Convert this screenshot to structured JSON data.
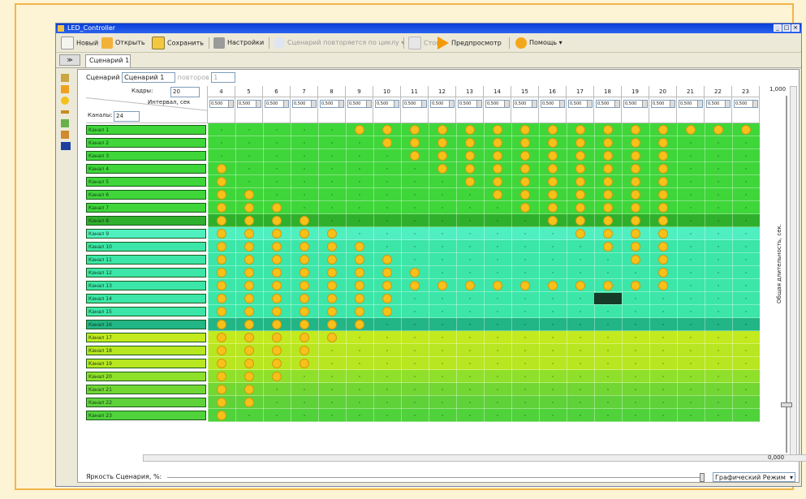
{
  "window": {
    "title": "LED_Controller",
    "controls": [
      "_",
      "□",
      "×"
    ]
  },
  "toolbar": {
    "items": [
      {
        "label": "Новый",
        "icon": "new-file-icon",
        "color": "#f5f5f0"
      },
      {
        "label": "Открыть",
        "icon": "open-folder-icon",
        "color": "#f2b23a"
      },
      {
        "label": "Сохранить",
        "icon": "save-disk-icon",
        "color": "#f2c840"
      },
      {
        "label": "Настройки",
        "icon": "tools-icon",
        "color": "#7a7a7a"
      }
    ],
    "loop_label": "Сценарий повторяется по циклу",
    "stop_label": "Стоп",
    "preview_label": "Предпросмотр",
    "help_label": "Помощь"
  },
  "tabs": {
    "nav": "≫",
    "active": "Сценарий 1"
  },
  "scenario": {
    "label": "Сценарий",
    "name": "Сценарий 1",
    "repeat_label": "повторов",
    "repeat_value": "1"
  },
  "grid": {
    "frames_label": "Кадры:",
    "frames_value": "20",
    "interval_label": "Интервал, сек",
    "channels_label": "Каналы:",
    "channels_value": "24",
    "interval_value": "0,500",
    "columns": [
      "4",
      "5",
      "6",
      "7",
      "8",
      "9",
      "10",
      "11",
      "12",
      "13",
      "14",
      "15",
      "16",
      "17",
      "18",
      "19",
      "20",
      "21",
      "22",
      "23"
    ],
    "rows": [
      "Канал 1",
      "Канал 2",
      "Канал 3",
      "Канал 4",
      "Канал 5",
      "Канал 6",
      "Канал 7",
      "Канал 8",
      "Канал 9",
      "Канал 10",
      "Канал 11",
      "Канал 12",
      "Канал 13",
      "Канал 14",
      "Канал 15",
      "Канал 16",
      "Канал 17",
      "Канал 18",
      "Канал 19",
      "Канал 20",
      "Канал 21",
      "Канал 22",
      "Канал 23"
    ],
    "row_colors": [
      "#3fd63a",
      "#3fd63a",
      "#3fd63a",
      "#3fd63a",
      "#3fd63a",
      "#3fd63a",
      "#3fd63a",
      "#2fb02c",
      "#4fefc0",
      "#3be6a8",
      "#3be6a8",
      "#3be6a8",
      "#3be6a8",
      "#3be6a8",
      "#3be6a8",
      "#22b585",
      "#c2ea1e",
      "#b8e620",
      "#b8e620",
      "#8fe02a",
      "#72d633",
      "#5fd23a",
      "#4fd23a"
    ],
    "active_cells": [
      [
        false,
        false,
        false,
        false,
        false,
        true,
        true,
        true,
        true,
        true,
        true,
        true,
        true,
        true,
        true,
        true,
        true,
        true,
        true,
        true
      ],
      [
        false,
        false,
        false,
        false,
        false,
        false,
        true,
        true,
        true,
        true,
        true,
        true,
        true,
        true,
        true,
        true,
        true,
        false,
        false,
        false
      ],
      [
        false,
        false,
        false,
        false,
        false,
        false,
        false,
        true,
        true,
        true,
        true,
        true,
        true,
        true,
        true,
        true,
        true,
        false,
        false,
        false
      ],
      [
        true,
        false,
        false,
        false,
        false,
        false,
        false,
        false,
        true,
        true,
        true,
        true,
        true,
        true,
        true,
        true,
        true,
        false,
        false,
        false
      ],
      [
        true,
        false,
        false,
        false,
        false,
        false,
        false,
        false,
        false,
        true,
        true,
        true,
        true,
        true,
        true,
        true,
        true,
        false,
        false,
        false
      ],
      [
        true,
        true,
        false,
        false,
        false,
        false,
        false,
        false,
        false,
        false,
        true,
        true,
        true,
        true,
        true,
        true,
        true,
        false,
        false,
        false
      ],
      [
        true,
        true,
        true,
        false,
        false,
        false,
        false,
        false,
        false,
        false,
        false,
        true,
        true,
        true,
        true,
        true,
        true,
        false,
        false,
        false
      ],
      [
        true,
        true,
        true,
        true,
        false,
        false,
        false,
        false,
        false,
        false,
        false,
        false,
        true,
        true,
        true,
        true,
        true,
        false,
        false,
        false
      ],
      [
        true,
        true,
        true,
        true,
        true,
        false,
        false,
        false,
        false,
        false,
        false,
        false,
        false,
        true,
        true,
        true,
        true,
        false,
        false,
        false
      ],
      [
        true,
        true,
        true,
        true,
        true,
        true,
        false,
        false,
        false,
        false,
        false,
        false,
        false,
        false,
        true,
        true,
        true,
        false,
        false,
        false
      ],
      [
        true,
        true,
        true,
        true,
        true,
        true,
        true,
        false,
        false,
        false,
        false,
        false,
        false,
        false,
        false,
        true,
        true,
        false,
        false,
        false
      ],
      [
        true,
        true,
        true,
        true,
        true,
        true,
        true,
        true,
        false,
        false,
        false,
        false,
        false,
        false,
        false,
        false,
        true,
        false,
        false,
        false
      ],
      [
        true,
        true,
        true,
        true,
        true,
        true,
        true,
        true,
        true,
        true,
        true,
        true,
        true,
        true,
        true,
        true,
        true,
        false,
        false,
        false
      ],
      [
        true,
        true,
        true,
        true,
        true,
        true,
        true,
        false,
        false,
        false,
        false,
        false,
        false,
        false,
        false,
        false,
        false,
        false,
        false,
        false
      ],
      [
        true,
        true,
        true,
        true,
        true,
        true,
        true,
        false,
        false,
        false,
        false,
        false,
        false,
        false,
        false,
        false,
        false,
        false,
        false,
        false
      ],
      [
        true,
        true,
        true,
        true,
        true,
        true,
        false,
        false,
        false,
        false,
        false,
        false,
        false,
        false,
        false,
        false,
        false,
        false,
        false,
        false
      ],
      [
        true,
        true,
        true,
        true,
        true,
        false,
        false,
        false,
        false,
        false,
        false,
        false,
        false,
        false,
        false,
        false,
        false,
        false,
        false,
        false
      ],
      [
        true,
        true,
        true,
        true,
        false,
        false,
        false,
        false,
        false,
        false,
        false,
        false,
        false,
        false,
        false,
        false,
        false,
        false,
        false,
        false
      ],
      [
        true,
        true,
        true,
        true,
        false,
        false,
        false,
        false,
        false,
        false,
        false,
        false,
        false,
        false,
        false,
        false,
        false,
        false,
        false,
        false
      ],
      [
        true,
        true,
        true,
        false,
        false,
        false,
        false,
        false,
        false,
        false,
        false,
        false,
        false,
        false,
        false,
        false,
        false,
        false,
        false,
        false
      ],
      [
        true,
        true,
        false,
        false,
        false,
        false,
        false,
        false,
        false,
        false,
        false,
        false,
        false,
        false,
        false,
        false,
        false,
        false,
        false,
        false
      ],
      [
        true,
        true,
        false,
        false,
        false,
        false,
        false,
        false,
        false,
        false,
        false,
        false,
        false,
        false,
        false,
        false,
        false,
        false,
        false,
        false
      ],
      [
        true,
        false,
        false,
        false,
        false,
        false,
        false,
        false,
        false,
        false,
        false,
        false,
        false,
        false,
        false,
        false,
        false,
        false,
        false,
        false
      ]
    ],
    "dot_color": "#f7c11a"
  },
  "right": {
    "top_value": "1,000",
    "bottom_value": "0,000",
    "axis_label": "Общая длительность, сек."
  },
  "footer": {
    "brightness_label": "Яркость Сценария, %:",
    "mode_value": "Графический Режим"
  }
}
